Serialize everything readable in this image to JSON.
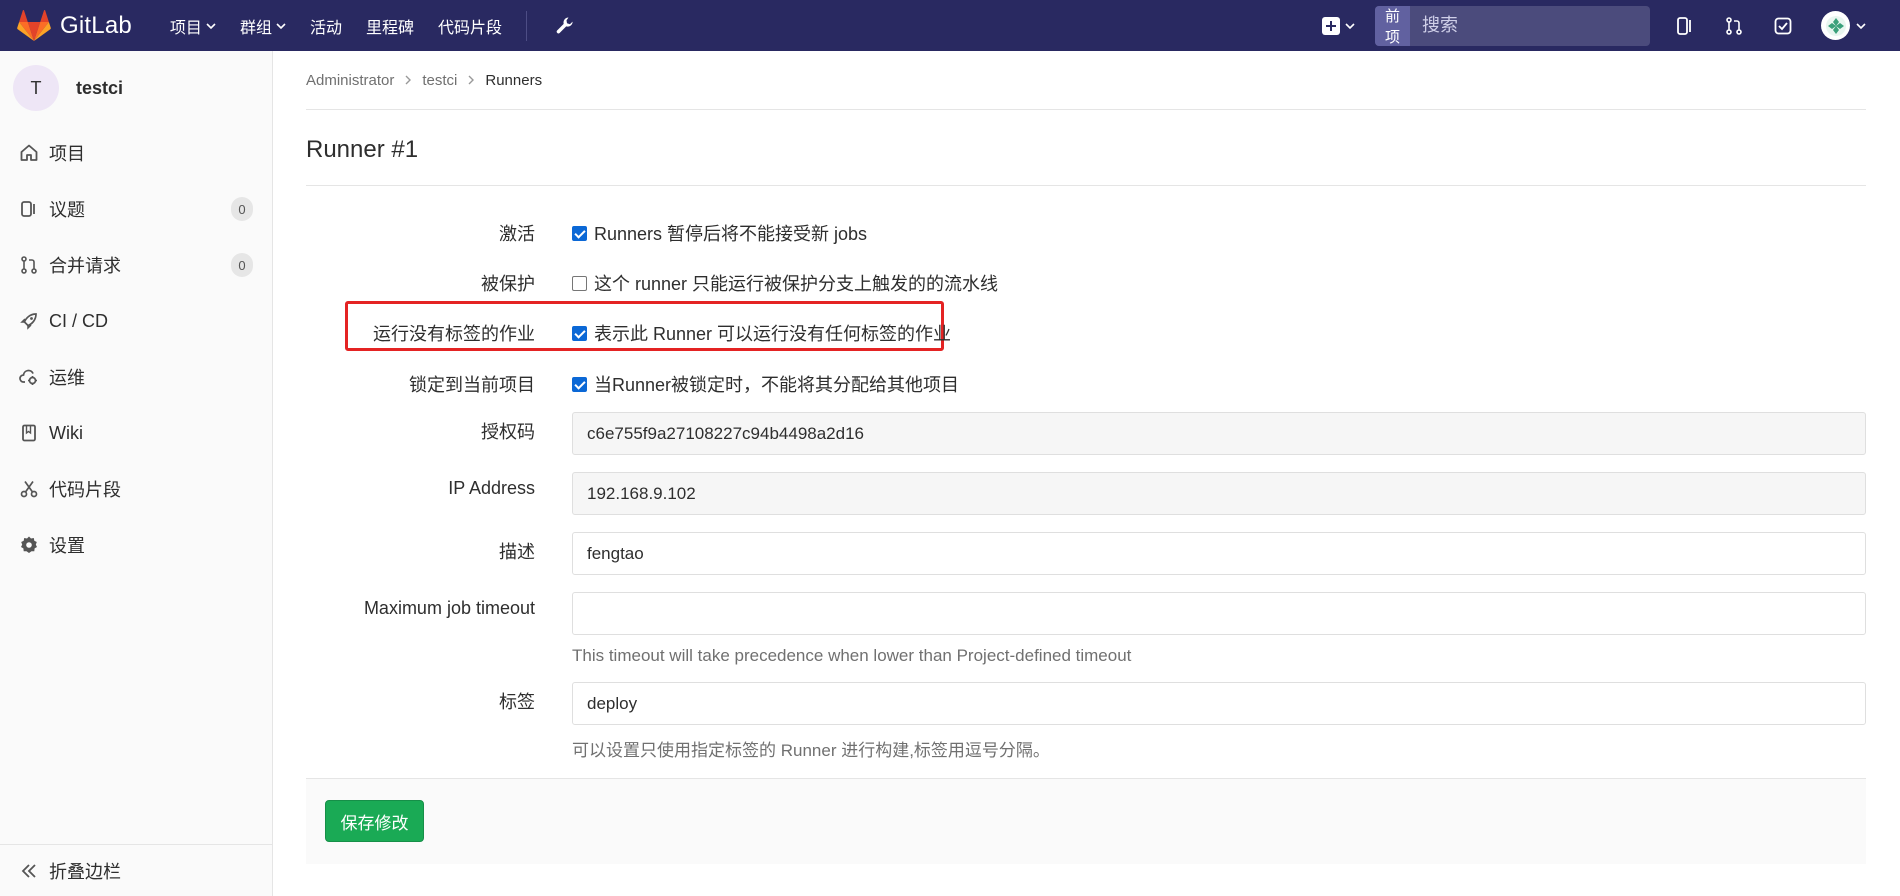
{
  "navbar": {
    "brand": "GitLab",
    "links": [
      "项目",
      "群组",
      "活动",
      "里程碑",
      "代码片段"
    ],
    "search_scope": "当前项目",
    "search_placeholder": "搜索"
  },
  "sidebar": {
    "project_initial": "T",
    "project_name": "testci",
    "items": [
      {
        "label": "项目"
      },
      {
        "label": "议题",
        "badge": "0"
      },
      {
        "label": "合并请求",
        "badge": "0"
      },
      {
        "label": "CI / CD"
      },
      {
        "label": "运维"
      },
      {
        "label": "Wiki"
      },
      {
        "label": "代码片段"
      },
      {
        "label": "设置"
      }
    ],
    "collapse_label": "折叠边栏"
  },
  "breadcrumb": [
    "Administrator",
    "testci",
    "Runners"
  ],
  "page_title": "Runner #1",
  "form": {
    "active": {
      "label": "激活",
      "text": "Runners 暂停后将不能接受新 jobs",
      "checked": true
    },
    "protected": {
      "label": "被保护",
      "text": "这个 runner 只能运行被保护分支上触发的的流水线",
      "checked": false
    },
    "run_untagged": {
      "label": "运行没有标签的作业",
      "text": "表示此 Runner 可以运行没有任何标签的作业",
      "checked": true
    },
    "locked": {
      "label": "锁定到当前项目",
      "text": "当Runner被锁定时，不能将其分配给其他项目",
      "checked": true
    },
    "token": {
      "label": "授权码",
      "value": "c6e755f9a27108227c94b4498a2d16"
    },
    "ip_address": {
      "label": "IP Address",
      "value": "192.168.9.102"
    },
    "description": {
      "label": "描述",
      "value": "fengtao"
    },
    "max_timeout": {
      "label": "Maximum job timeout",
      "value": "",
      "help": "This timeout will take precedence when lower than Project-defined timeout"
    },
    "tags": {
      "label": "标签",
      "value": "deploy",
      "help": "可以设置只使用指定标签的 Runner 进行构建,标签用逗号分隔。"
    },
    "save_label": "保存修改"
  },
  "colors": {
    "navbar": "#292961",
    "save": "#1aaa55",
    "highlight": "#e42323",
    "checkbox": "#0b68d6"
  }
}
